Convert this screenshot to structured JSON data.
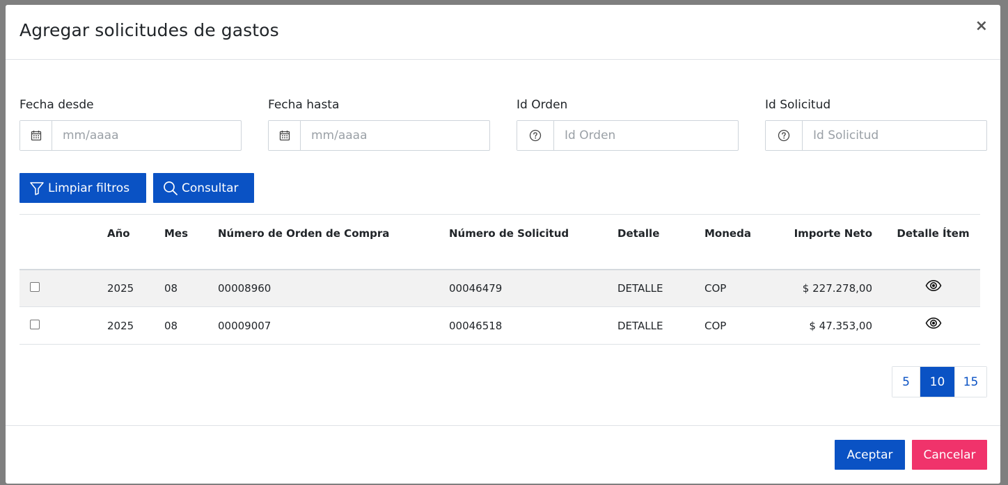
{
  "modal": {
    "title": "Agregar solicitudes de gastos",
    "close_label": "×"
  },
  "filters": {
    "fecha_desde": {
      "label": "Fecha desde",
      "placeholder": "mm/aaaa",
      "icon": "calendar-icon"
    },
    "fecha_hasta": {
      "label": "Fecha hasta",
      "placeholder": "mm/aaaa",
      "icon": "calendar-icon"
    },
    "id_orden": {
      "label": "Id Orden",
      "placeholder": "Id Orden",
      "icon": "question-circle-icon"
    },
    "id_solicitud": {
      "label": "Id Solicitud",
      "placeholder": "Id Solicitud",
      "icon": "question-circle-icon"
    }
  },
  "actions": {
    "clear_label": "Limpiar filtros",
    "clear_icon": "filter-icon",
    "query_label": "Consultar",
    "query_icon": "search-icon"
  },
  "table": {
    "columns": [
      "",
      "Año",
      "Mes",
      "Número de Orden de Compra",
      "Número de Solicitud",
      "Detalle",
      "Moneda",
      "Importe Neto",
      "Detalle Ítem"
    ],
    "rows": [
      {
        "checked": false,
        "anio": "2025",
        "mes": "08",
        "orden": "00008960",
        "solicitud": "00046479",
        "detalle": "DETALLE",
        "moneda": "COP",
        "importe": "$ 227.278,00",
        "detalle_icon": "eye-icon"
      },
      {
        "checked": false,
        "anio": "2025",
        "mes": "08",
        "orden": "00009007",
        "solicitud": "00046518",
        "detalle": "DETALLE",
        "moneda": "COP",
        "importe": "$ 47.353,00",
        "detalle_icon": "eye-icon"
      }
    ]
  },
  "pagination": {
    "options": [
      "5",
      "10",
      "15"
    ],
    "selected": "10"
  },
  "footer": {
    "accept_label": "Aceptar",
    "cancel_label": "Cancelar"
  },
  "colors": {
    "primary": "#0a52c4",
    "danger": "#f0336b"
  }
}
